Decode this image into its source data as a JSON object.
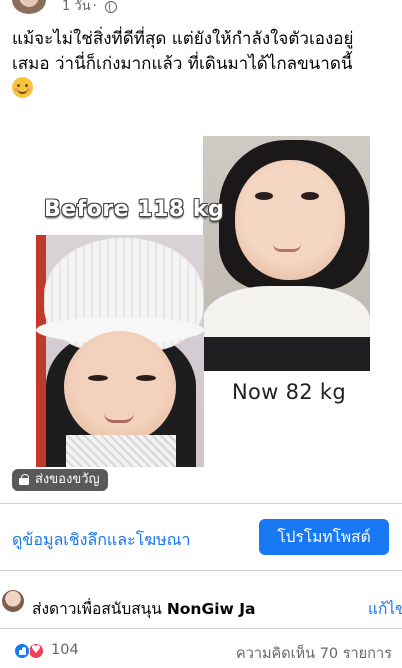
{
  "post": {
    "time": "1 วัน",
    "caption_line1": "แม้จะไม่ใช่สิ่งที่ดีที่สุด แต่ยังให้กำลังใจตัวเองอยู่",
    "caption_line2": "เสมอ ว่านี่ก็เก่งมากแล้ว ที่เดินมาได้ไกลขนาดนี้",
    "caption_emoji": "smiling-face-emoji"
  },
  "media": {
    "before_label": "Before 118 kg",
    "now_label": "Now 82 kg"
  },
  "gift_badge": {
    "label": "ส่งของขวัญ",
    "icon": "gift-icon"
  },
  "actions": {
    "insights_label": "ดูข้อมูลเชิงลึกและโฆษณา",
    "promote_label": "โปรโมทโพสต์"
  },
  "support": {
    "prefix": "ส่งดาวเพื่อสนับสนุน",
    "name": "NonGiw Ja",
    "edit_label": "แก้ไข"
  },
  "reactions": {
    "count": "104",
    "comments": "ความคิดเห็น 70 รายการ"
  },
  "colors": {
    "accent": "#1877f2",
    "secondary_text": "#65676b",
    "love": "#f33e58"
  }
}
